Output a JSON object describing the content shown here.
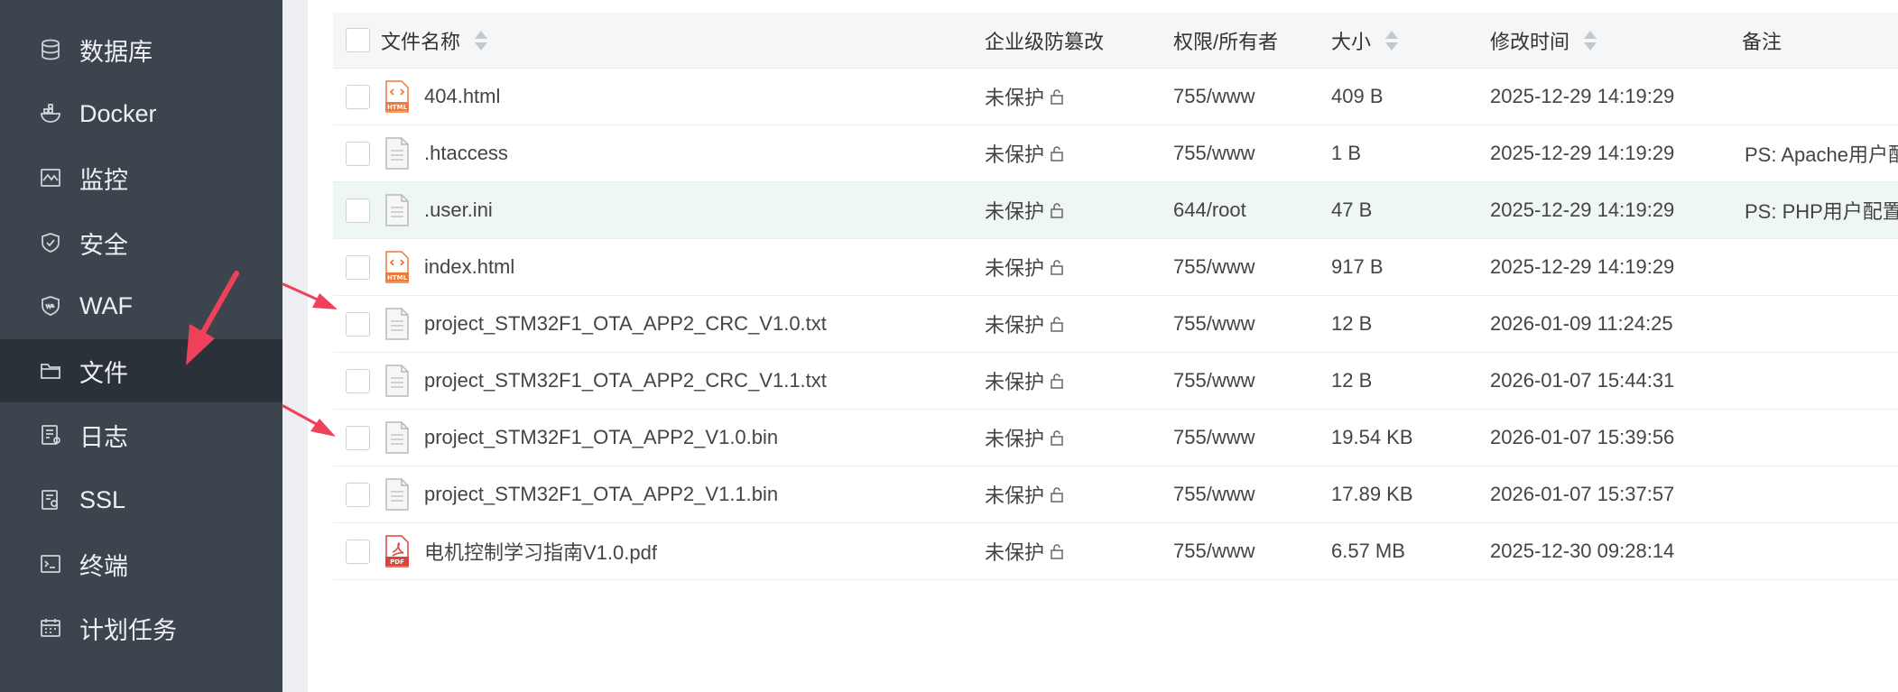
{
  "sidebar": {
    "items": [
      {
        "label": "数据库",
        "icon": "database-icon"
      },
      {
        "label": "Docker",
        "icon": "docker-icon"
      },
      {
        "label": "监控",
        "icon": "monitor-icon"
      },
      {
        "label": "安全",
        "icon": "shield-icon"
      },
      {
        "label": "WAF",
        "icon": "waf-shield-icon"
      },
      {
        "label": "文件",
        "icon": "folder-icon",
        "active": true
      },
      {
        "label": "日志",
        "icon": "log-icon"
      },
      {
        "label": "SSL",
        "icon": "ssl-certificate-icon"
      },
      {
        "label": "终端",
        "icon": "terminal-icon"
      },
      {
        "label": "计划任务",
        "icon": "calendar-icon"
      }
    ]
  },
  "table": {
    "headers": {
      "name": "文件名称",
      "tamper": "企业级防篡改",
      "perm": "权限/所有者",
      "size": "大小",
      "mtime": "修改时间",
      "note": "备注"
    },
    "rows": [
      {
        "name": "404.html",
        "type": "html",
        "tamper": "未保护",
        "perm": "755/www",
        "size": "409 B",
        "mtime": "2025-12-29 14:19:29",
        "note": ""
      },
      {
        "name": ".htaccess",
        "type": "text",
        "tamper": "未保护",
        "perm": "755/www",
        "size": "1 B",
        "mtime": "2025-12-29 14:19:29",
        "note": "PS: Apache用户配置"
      },
      {
        "name": ".user.ini",
        "type": "text",
        "tamper": "未保护",
        "perm": "644/root",
        "size": "47 B",
        "mtime": "2025-12-29 14:19:29",
        "note": "PS: PHP用户配置文",
        "highlight": true
      },
      {
        "name": "index.html",
        "type": "html",
        "tamper": "未保护",
        "perm": "755/www",
        "size": "917 B",
        "mtime": "2025-12-29 14:19:29",
        "note": ""
      },
      {
        "name": "project_STM32F1_OTA_APP2_CRC_V1.0.txt",
        "type": "text",
        "tamper": "未保护",
        "perm": "755/www",
        "size": "12 B",
        "mtime": "2026-01-09 11:24:25",
        "note": ""
      },
      {
        "name": "project_STM32F1_OTA_APP2_CRC_V1.1.txt",
        "type": "text",
        "tamper": "未保护",
        "perm": "755/www",
        "size": "12 B",
        "mtime": "2026-01-07 15:44:31",
        "note": ""
      },
      {
        "name": "project_STM32F1_OTA_APP2_V1.0.bin",
        "type": "text",
        "tamper": "未保护",
        "perm": "755/www",
        "size": "19.54 KB",
        "mtime": "2026-01-07 15:39:56",
        "note": ""
      },
      {
        "name": "project_STM32F1_OTA_APP2_V1.1.bin",
        "type": "text",
        "tamper": "未保护",
        "perm": "755/www",
        "size": "17.89 KB",
        "mtime": "2026-01-07 15:37:57",
        "note": ""
      },
      {
        "name": "电机控制学习指南V1.0.pdf",
        "type": "pdf",
        "tamper": "未保护",
        "perm": "755/www",
        "size": "6.57 MB",
        "mtime": "2025-12-30 09:28:14",
        "note": ""
      }
    ]
  },
  "icons": {
    "html_label": "HTML",
    "pdf_label": "PDF"
  },
  "colors": {
    "sidebar_bg": "#3c444d",
    "sidebar_active": "#2b3138",
    "arrow": "#f0415a",
    "row_highlight": "#eef7f5",
    "html_icon": "#f07a3c",
    "pdf_icon": "#d9453c"
  }
}
